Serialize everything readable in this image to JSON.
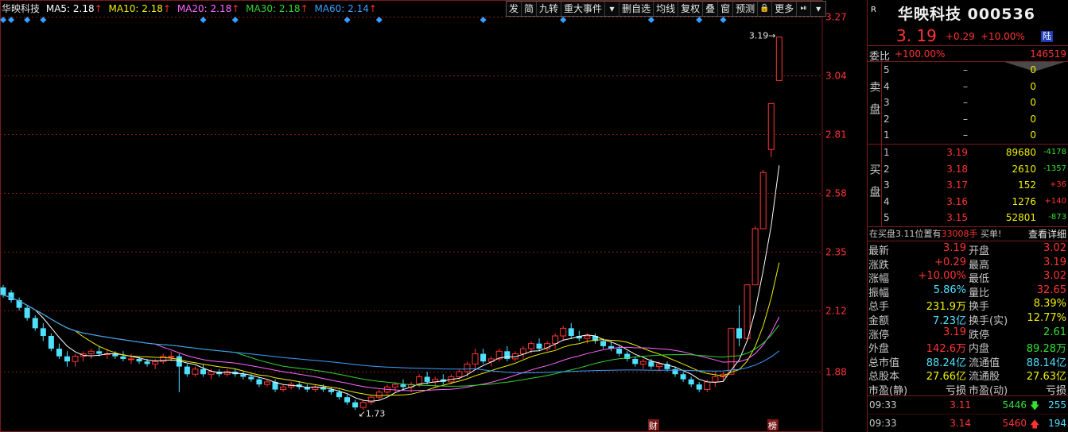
{
  "legend": {
    "name": "华映科技",
    "ma5": "MA5: 2.18",
    "ma10": "MA10: 2.18",
    "ma20": "MA20: 2.18",
    "ma30": "MA30: 2.18",
    "ma60": "MA60: 2.14",
    "arrow": "↑"
  },
  "toolbar": [
    "发",
    "简",
    "九转",
    "重大事件",
    "▾",
    "删自选",
    "均线",
    "复权",
    "叠",
    "窗",
    "预测",
    "🔒",
    "更多",
    "⏯",
    "▾"
  ],
  "colors": {
    "up": "#ff3333",
    "down": "#4fe0ff",
    "ma5": "#ffffff",
    "ma10": "#f0f000",
    "ma20": "#ff66ff",
    "ma30": "#33d633",
    "ma60": "#3aa0ff",
    "grid": "#8b1a1a"
  },
  "chart_data": {
    "type": "candlestick",
    "y_ticks": [
      "3.27",
      "3.04",
      "2.81",
      "2.58",
      "2.35",
      "2.12",
      "1.88"
    ],
    "ylim": [
      1.65,
      3.27
    ],
    "labels": {
      "max": "3.19",
      "min": "1.73"
    },
    "markers": {
      "cai": "财",
      "bang": "榜"
    },
    "candles": [
      [
        2.21,
        2.22,
        2.17,
        2.18
      ],
      [
        2.19,
        2.2,
        2.15,
        2.16
      ],
      [
        2.16,
        2.17,
        2.12,
        2.13
      ],
      [
        2.13,
        2.14,
        2.08,
        2.09
      ],
      [
        2.09,
        2.1,
        2.04,
        2.05
      ],
      [
        2.05,
        2.07,
        2.0,
        2.02
      ],
      [
        2.02,
        2.03,
        1.96,
        1.97
      ],
      [
        1.97,
        1.99,
        1.93,
        1.94
      ],
      [
        1.94,
        1.96,
        1.9,
        1.92
      ],
      [
        1.92,
        1.95,
        1.9,
        1.94
      ],
      [
        1.94,
        1.96,
        1.92,
        1.95
      ],
      [
        1.95,
        1.97,
        1.93,
        1.96
      ],
      [
        1.96,
        1.98,
        1.94,
        1.95
      ],
      [
        1.95,
        1.97,
        1.93,
        1.95
      ],
      [
        1.95,
        1.96,
        1.93,
        1.94
      ],
      [
        1.94,
        1.96,
        1.92,
        1.93
      ],
      [
        1.93,
        1.95,
        1.91,
        1.93
      ],
      [
        1.93,
        1.94,
        1.91,
        1.92
      ],
      [
        1.92,
        1.93,
        1.9,
        1.91
      ],
      [
        1.91,
        1.93,
        1.89,
        1.92
      ],
      [
        1.92,
        1.95,
        1.91,
        1.94
      ],
      [
        1.94,
        1.96,
        1.92,
        1.94
      ],
      [
        1.94,
        1.95,
        1.8,
        1.9
      ],
      [
        1.9,
        1.91,
        1.86,
        1.87
      ],
      [
        1.87,
        1.9,
        1.86,
        1.89
      ],
      [
        1.89,
        1.91,
        1.86,
        1.87
      ],
      [
        1.87,
        1.89,
        1.85,
        1.88
      ],
      [
        1.88,
        1.89,
        1.86,
        1.87
      ],
      [
        1.87,
        1.89,
        1.86,
        1.88
      ],
      [
        1.88,
        1.89,
        1.86,
        1.87
      ],
      [
        1.87,
        1.88,
        1.85,
        1.86
      ],
      [
        1.86,
        1.87,
        1.84,
        1.85
      ],
      [
        1.85,
        1.86,
        1.82,
        1.83
      ],
      [
        1.83,
        1.85,
        1.82,
        1.84
      ],
      [
        1.84,
        1.85,
        1.8,
        1.81
      ],
      [
        1.81,
        1.83,
        1.8,
        1.82
      ],
      [
        1.82,
        1.84,
        1.81,
        1.83
      ],
      [
        1.83,
        1.84,
        1.81,
        1.82
      ],
      [
        1.82,
        1.83,
        1.8,
        1.81
      ],
      [
        1.81,
        1.83,
        1.8,
        1.82
      ],
      [
        1.82,
        1.83,
        1.8,
        1.81
      ],
      [
        1.81,
        1.82,
        1.79,
        1.8
      ],
      [
        1.8,
        1.81,
        1.77,
        1.78
      ],
      [
        1.78,
        1.79,
        1.75,
        1.76
      ],
      [
        1.76,
        1.77,
        1.73,
        1.74
      ],
      [
        1.74,
        1.77,
        1.73,
        1.76
      ],
      [
        1.76,
        1.79,
        1.75,
        1.78
      ],
      [
        1.78,
        1.81,
        1.77,
        1.8
      ],
      [
        1.8,
        1.83,
        1.79,
        1.82
      ],
      [
        1.82,
        1.84,
        1.8,
        1.83
      ],
      [
        1.83,
        1.85,
        1.81,
        1.82
      ],
      [
        1.82,
        1.84,
        1.8,
        1.83
      ],
      [
        1.83,
        1.87,
        1.82,
        1.86
      ],
      [
        1.86,
        1.88,
        1.83,
        1.84
      ],
      [
        1.84,
        1.86,
        1.82,
        1.85
      ],
      [
        1.85,
        1.87,
        1.83,
        1.84
      ],
      [
        1.84,
        1.87,
        1.83,
        1.86
      ],
      [
        1.86,
        1.89,
        1.85,
        1.88
      ],
      [
        1.88,
        1.92,
        1.86,
        1.91
      ],
      [
        1.91,
        1.97,
        1.89,
        1.95
      ],
      [
        1.95,
        1.97,
        1.91,
        1.92
      ],
      [
        1.92,
        1.94,
        1.9,
        1.93
      ],
      [
        1.93,
        1.97,
        1.92,
        1.96
      ],
      [
        1.96,
        1.98,
        1.92,
        1.93
      ],
      [
        1.93,
        1.96,
        1.92,
        1.95
      ],
      [
        1.95,
        1.98,
        1.93,
        1.97
      ],
      [
        1.97,
        2.0,
        1.95,
        1.99
      ],
      [
        1.99,
        2.01,
        1.96,
        1.97
      ],
      [
        1.97,
        2.0,
        1.96,
        1.99
      ],
      [
        1.99,
        2.03,
        1.97,
        2.02
      ],
      [
        2.02,
        2.06,
        2.0,
        2.05
      ],
      [
        2.05,
        2.07,
        2.01,
        2.02
      ],
      [
        2.02,
        2.04,
        2.0,
        2.01
      ],
      [
        2.01,
        2.03,
        1.99,
        2.02
      ],
      [
        2.02,
        2.03,
        1.99,
        2.0
      ],
      [
        2.0,
        2.01,
        1.97,
        1.98
      ],
      [
        1.98,
        2.0,
        1.96,
        1.97
      ],
      [
        1.97,
        1.98,
        1.94,
        1.95
      ],
      [
        1.95,
        1.96,
        1.92,
        1.93
      ],
      [
        1.93,
        1.94,
        1.9,
        1.91
      ],
      [
        1.91,
        1.93,
        1.89,
        1.92
      ],
      [
        1.92,
        1.93,
        1.89,
        1.9
      ],
      [
        1.9,
        1.92,
        1.88,
        1.91
      ],
      [
        1.91,
        1.92,
        1.88,
        1.89
      ],
      [
        1.89,
        1.9,
        1.86,
        1.87
      ],
      [
        1.87,
        1.88,
        1.84,
        1.85
      ],
      [
        1.85,
        1.86,
        1.82,
        1.83
      ],
      [
        1.83,
        1.84,
        1.8,
        1.81
      ],
      [
        1.81,
        1.85,
        1.8,
        1.84
      ],
      [
        1.84,
        1.88,
        1.82,
        1.86
      ],
      [
        1.86,
        1.88,
        1.84,
        1.87
      ],
      [
        1.87,
        2.05,
        1.87,
        2.05
      ],
      [
        2.05,
        2.14,
        1.98,
        2.01
      ],
      [
        2.01,
        2.22,
        2.0,
        2.22
      ],
      [
        2.22,
        2.45,
        2.22,
        2.44
      ],
      [
        2.44,
        2.67,
        2.44,
        2.66
      ],
      [
        2.75,
        2.93,
        2.72,
        2.93
      ],
      [
        3.02,
        3.19,
        3.02,
        3.19
      ]
    ]
  },
  "panel": {
    "badge": "R",
    "title": "华映科技 000536",
    "price": "3. 19",
    "change": "+0.29",
    "pct": "+10.00%",
    "lu": "陆",
    "webi_label": "委比",
    "webi_pct": "+100.00%",
    "webi_val": "146519",
    "sell_label": "卖盘",
    "buy_label": "买盘",
    "sell": [
      {
        "lv": "5",
        "pr": "–",
        "vo": "0",
        "df": ""
      },
      {
        "lv": "4",
        "pr": "–",
        "vo": "0",
        "df": ""
      },
      {
        "lv": "3",
        "pr": "–",
        "vo": "0",
        "df": ""
      },
      {
        "lv": "2",
        "pr": "–",
        "vo": "0",
        "df": ""
      },
      {
        "lv": "1",
        "pr": "–",
        "vo": "0",
        "df": ""
      }
    ],
    "buy": [
      {
        "lv": "1",
        "pr": "3.19",
        "vo": "89680",
        "df": "-4178"
      },
      {
        "lv": "2",
        "pr": "3.18",
        "vo": "2610",
        "df": "-1357"
      },
      {
        "lv": "3",
        "pr": "3.17",
        "vo": "152",
        "df": "+36"
      },
      {
        "lv": "4",
        "pr": "3.16",
        "vo": "1276",
        "df": "+140"
      },
      {
        "lv": "5",
        "pr": "3.15",
        "vo": "52801",
        "df": "-873"
      }
    ],
    "notice_a": "在买盘3.11位置有",
    "notice_b": "33008手",
    "notice_c": "买单!",
    "notice_more": "查看详细",
    "stats": [
      {
        "k1": "最新",
        "v1": "3.19",
        "c1": "red",
        "k2": "开盘",
        "v2": "3.02",
        "c2": "red"
      },
      {
        "k1": "涨跌",
        "v1": "+0.29",
        "c1": "red",
        "k2": "最高",
        "v2": "3.19",
        "c2": "red"
      },
      {
        "k1": "涨幅",
        "v1": "+10.00%",
        "c1": "red",
        "k2": "最低",
        "v2": "3.02",
        "c2": "red"
      },
      {
        "k1": "振幅",
        "v1": "5.86%",
        "c1": "cyan",
        "k2": "量比",
        "v2": "32.65",
        "c2": "red"
      },
      {
        "k1": "总手",
        "v1": "231.9万",
        "c1": "yellow",
        "k2": "换手",
        "v2": "8.39%",
        "c2": "yellow"
      },
      {
        "k1": "金额",
        "v1": "7.23亿",
        "c1": "cyan",
        "k2": "换手(实)",
        "v2": "12.77%",
        "c2": "yellow"
      },
      {
        "k1": "涨停",
        "v1": "3.19",
        "c1": "red",
        "k2": "跌停",
        "v2": "2.61",
        "c2": "green"
      },
      {
        "k1": "外盘",
        "v1": "142.6万",
        "c1": "red",
        "k2": "内盘",
        "v2": "89.28万",
        "c2": "green"
      },
      {
        "k1": "总市值",
        "v1": "88.24亿",
        "c1": "cyan",
        "k2": "流通值",
        "v2": "88.14亿",
        "c2": "cyan"
      },
      {
        "k1": "总股本",
        "v1": "27.66亿",
        "c1": "yellow",
        "k2": "流通股",
        "v2": "27.63亿",
        "c2": "yellow"
      },
      {
        "k1": "市盈(静)",
        "v1": "亏损",
        "c1": "white",
        "k2": "市盈(动)",
        "v2": "亏损",
        "c2": "white"
      }
    ],
    "ticks": [
      {
        "t": "09:33",
        "p": "3.11",
        "q": "5446",
        "qc": "green",
        "ar": "🡇",
        "arc": "green",
        "n": "255"
      },
      {
        "t": "09:33",
        "p": "3.14",
        "q": "5460",
        "qc": "red",
        "ar": "🡅",
        "arc": "red",
        "n": "194"
      }
    ]
  }
}
